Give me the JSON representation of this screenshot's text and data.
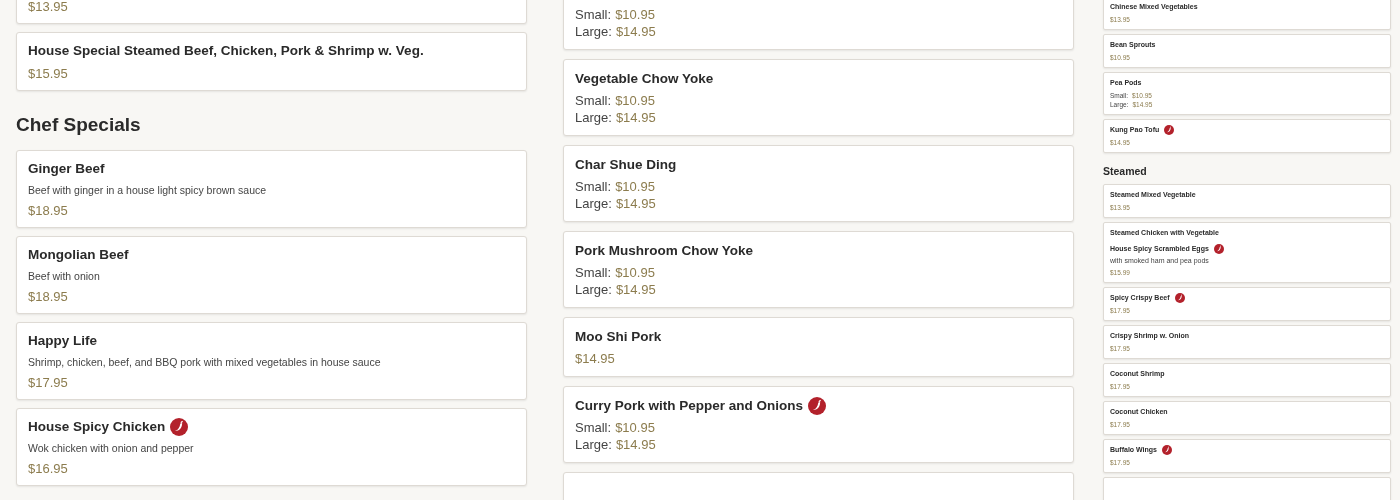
{
  "columns": [
    {
      "entries": [
        {
          "kind": "item",
          "price": "$13.95"
        },
        {
          "kind": "item",
          "name": "House Special Steamed Beef, Chicken, Pork & Shrimp w. Veg.",
          "spicy": false,
          "price": "$15.95"
        },
        {
          "kind": "section",
          "title": "Chef Specials"
        },
        {
          "kind": "item",
          "name": "Ginger Beef",
          "spicy": false,
          "description": "Beef with ginger in a house light spicy brown sauce",
          "price": "$18.95"
        },
        {
          "kind": "item",
          "name": "Mongolian Beef",
          "spicy": false,
          "description": "Beef with onion",
          "price": "$18.95"
        },
        {
          "kind": "item",
          "name": "Happy Life",
          "spicy": false,
          "description": "Shrimp, chicken, beef, and BBQ pork with mixed vegetables in house sauce",
          "price": "$17.95"
        },
        {
          "kind": "item",
          "name": "House Spicy Chicken",
          "spicy": true,
          "description": "Wok chicken with onion and pepper",
          "price": "$16.95"
        }
      ]
    },
    {
      "entries": [
        {
          "kind": "item",
          "sizes": [
            {
              "label": "Small:",
              "price": "$10.95"
            },
            {
              "label": "Large:",
              "price": "$14.95"
            }
          ]
        },
        {
          "kind": "item",
          "name": "Vegetable Chow Yoke",
          "spicy": false,
          "sizes": [
            {
              "label": "Small:",
              "price": "$10.95"
            },
            {
              "label": "Large:",
              "price": "$14.95"
            }
          ]
        },
        {
          "kind": "item",
          "name": "Char Shue Ding",
          "spicy": false,
          "sizes": [
            {
              "label": "Small:",
              "price": "$10.95"
            },
            {
              "label": "Large:",
              "price": "$14.95"
            }
          ]
        },
        {
          "kind": "item",
          "name": "Pork Mushroom Chow Yoke",
          "spicy": false,
          "sizes": [
            {
              "label": "Small:",
              "price": "$10.95"
            },
            {
              "label": "Large:",
              "price": "$14.95"
            }
          ]
        },
        {
          "kind": "item",
          "name": "Moo Shi Pork",
          "spicy": false,
          "price": "$14.95"
        },
        {
          "kind": "item",
          "name": "Curry Pork with Pepper and Onions",
          "spicy": true,
          "sizes": [
            {
              "label": "Small:",
              "price": "$10.95"
            },
            {
              "label": "Large:",
              "price": "$14.95"
            }
          ]
        },
        {
          "kind": "item"
        }
      ]
    },
    {
      "entries": [
        {
          "kind": "item",
          "name": "Chinese Mixed Vegetables",
          "spicy": false,
          "price": "$13.95"
        },
        {
          "kind": "item",
          "name": "Bean Sprouts",
          "spicy": false,
          "price": "$10.95"
        },
        {
          "kind": "item",
          "name": "Pea Pods",
          "spicy": false,
          "sizes": [
            {
              "label": "Small:",
              "price": "$10.95"
            },
            {
              "label": "Large:",
              "price": "$14.95"
            }
          ]
        },
        {
          "kind": "item",
          "name": "Kung Pao Tofu",
          "spicy": true,
          "price": "$14.95"
        },
        {
          "kind": "section",
          "title": "Steamed"
        },
        {
          "kind": "item",
          "name": "Steamed Mixed Vegetable",
          "spicy": false,
          "price": "$13.95"
        },
        {
          "kind": "item",
          "covered_name": "Steamed Chicken with Vegetable",
          "name": "House Spicy Scrambled Eggs",
          "spicy": true,
          "description": "with smoked ham and pea pods",
          "price": "$15.99"
        },
        {
          "kind": "item",
          "name": "Spicy Crispy Beef",
          "spicy": true,
          "price": "$17.95"
        },
        {
          "kind": "item",
          "name": "Crispy Shrimp w. Onion",
          "spicy": false,
          "price": "$17.95"
        },
        {
          "kind": "item",
          "name": "Coconut Shrimp",
          "spicy": false,
          "price": "$17.95"
        },
        {
          "kind": "item",
          "name": "Coconut Chicken",
          "spicy": false,
          "price": "$17.95"
        },
        {
          "kind": "item",
          "name": "Buffalo Wings",
          "spicy": true,
          "price": "$17.95"
        },
        {
          "kind": "item"
        }
      ]
    }
  ]
}
